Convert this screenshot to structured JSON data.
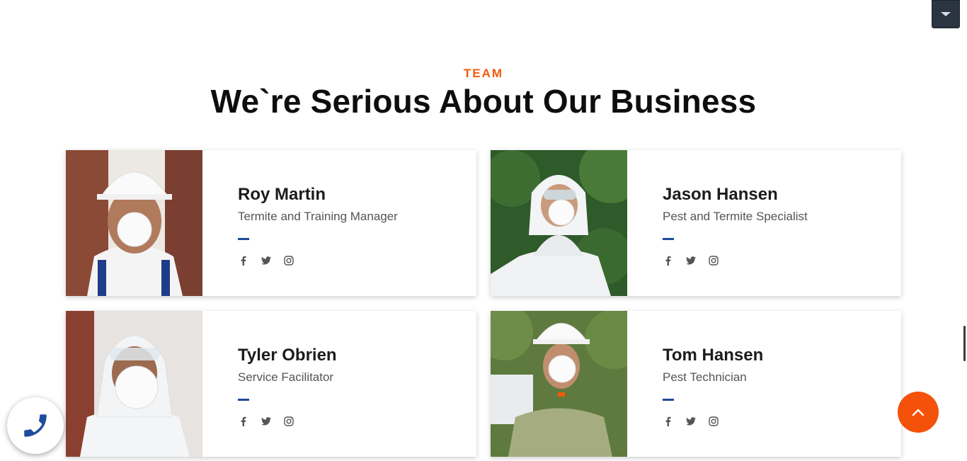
{
  "section": {
    "eyebrow": "TEAM",
    "title": "We`re Serious About Our Business"
  },
  "team": [
    {
      "name": "Roy Martin",
      "role": "Termite and Training Manager"
    },
    {
      "name": "Jason Hansen",
      "role": "Pest and Termite Specialist"
    },
    {
      "name": "Tyler Obrien",
      "role": "Service Facilitator"
    },
    {
      "name": "Tom Hansen",
      "role": "Pest Technician"
    }
  ],
  "socials": [
    "facebook-icon",
    "twitter-icon",
    "instagram-icon"
  ],
  "colors": {
    "accent": "#f25a0a",
    "rule": "#1d4c9c",
    "dropdown": "#2b3441",
    "back_to_top": "#f4520b",
    "call_icon": "#1d4c9c"
  }
}
